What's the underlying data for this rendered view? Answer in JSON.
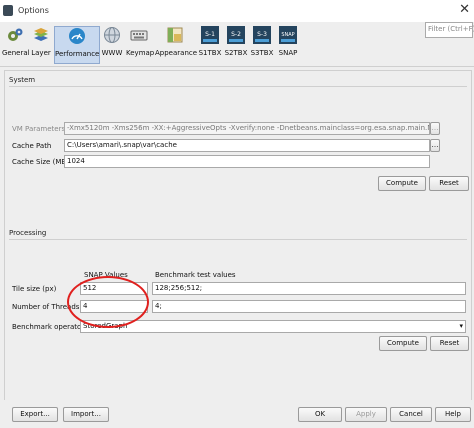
{
  "window": {
    "title": "Options",
    "close_glyph": "✕"
  },
  "toolbar": {
    "items": [
      {
        "label": "General"
      },
      {
        "label": "Layer"
      },
      {
        "label": "Performance"
      },
      {
        "label": "WWW"
      },
      {
        "label": "Keymap"
      },
      {
        "label": "Appearance"
      },
      {
        "label": "S1TBX"
      },
      {
        "label": "S2TBX"
      },
      {
        "label": "S3TBX"
      },
      {
        "label": "SNAP"
      }
    ],
    "active": "Performance",
    "filter_placeholder": "Filter (Ctrl+F)"
  },
  "system": {
    "title": "System",
    "vm_parameters_label": "VM Parameters",
    "vm_parameters_value": "-Xmx5120m -Xms256m -XX:+AggressiveOpts -Xverify:none -Dnetbeans.mainclass=org.esa.snap.main.Main -Dsun...",
    "cache_path_label": "Cache Path",
    "cache_path_value": "C:\\Users\\amari\\.snap\\var\\cache",
    "cache_size_label": "Cache Size (MB)",
    "cache_size_value": "1024",
    "compute_label": "Compute",
    "reset_label": "Reset"
  },
  "processing": {
    "title": "Processing",
    "snap_values_header": "SNAP Values",
    "benchmark_header": "Benchmark test values",
    "tile_size_label": "Tile size (px)",
    "tile_size_snap": "512",
    "tile_size_benchmark": "128;256;512;",
    "threads_label": "Number of Threads",
    "threads_snap": "4",
    "threads_benchmark": "4;",
    "benchmark_operator_label": "Benchmark operator",
    "benchmark_operator_value": "StoredGraph",
    "compute_label": "Compute",
    "reset_label": "Reset"
  },
  "footer": {
    "export_label": "Export...",
    "import_label": "Import...",
    "ok_label": "OK",
    "apply_label": "Apply",
    "cancel_label": "Cancel",
    "help_label": "Help"
  }
}
